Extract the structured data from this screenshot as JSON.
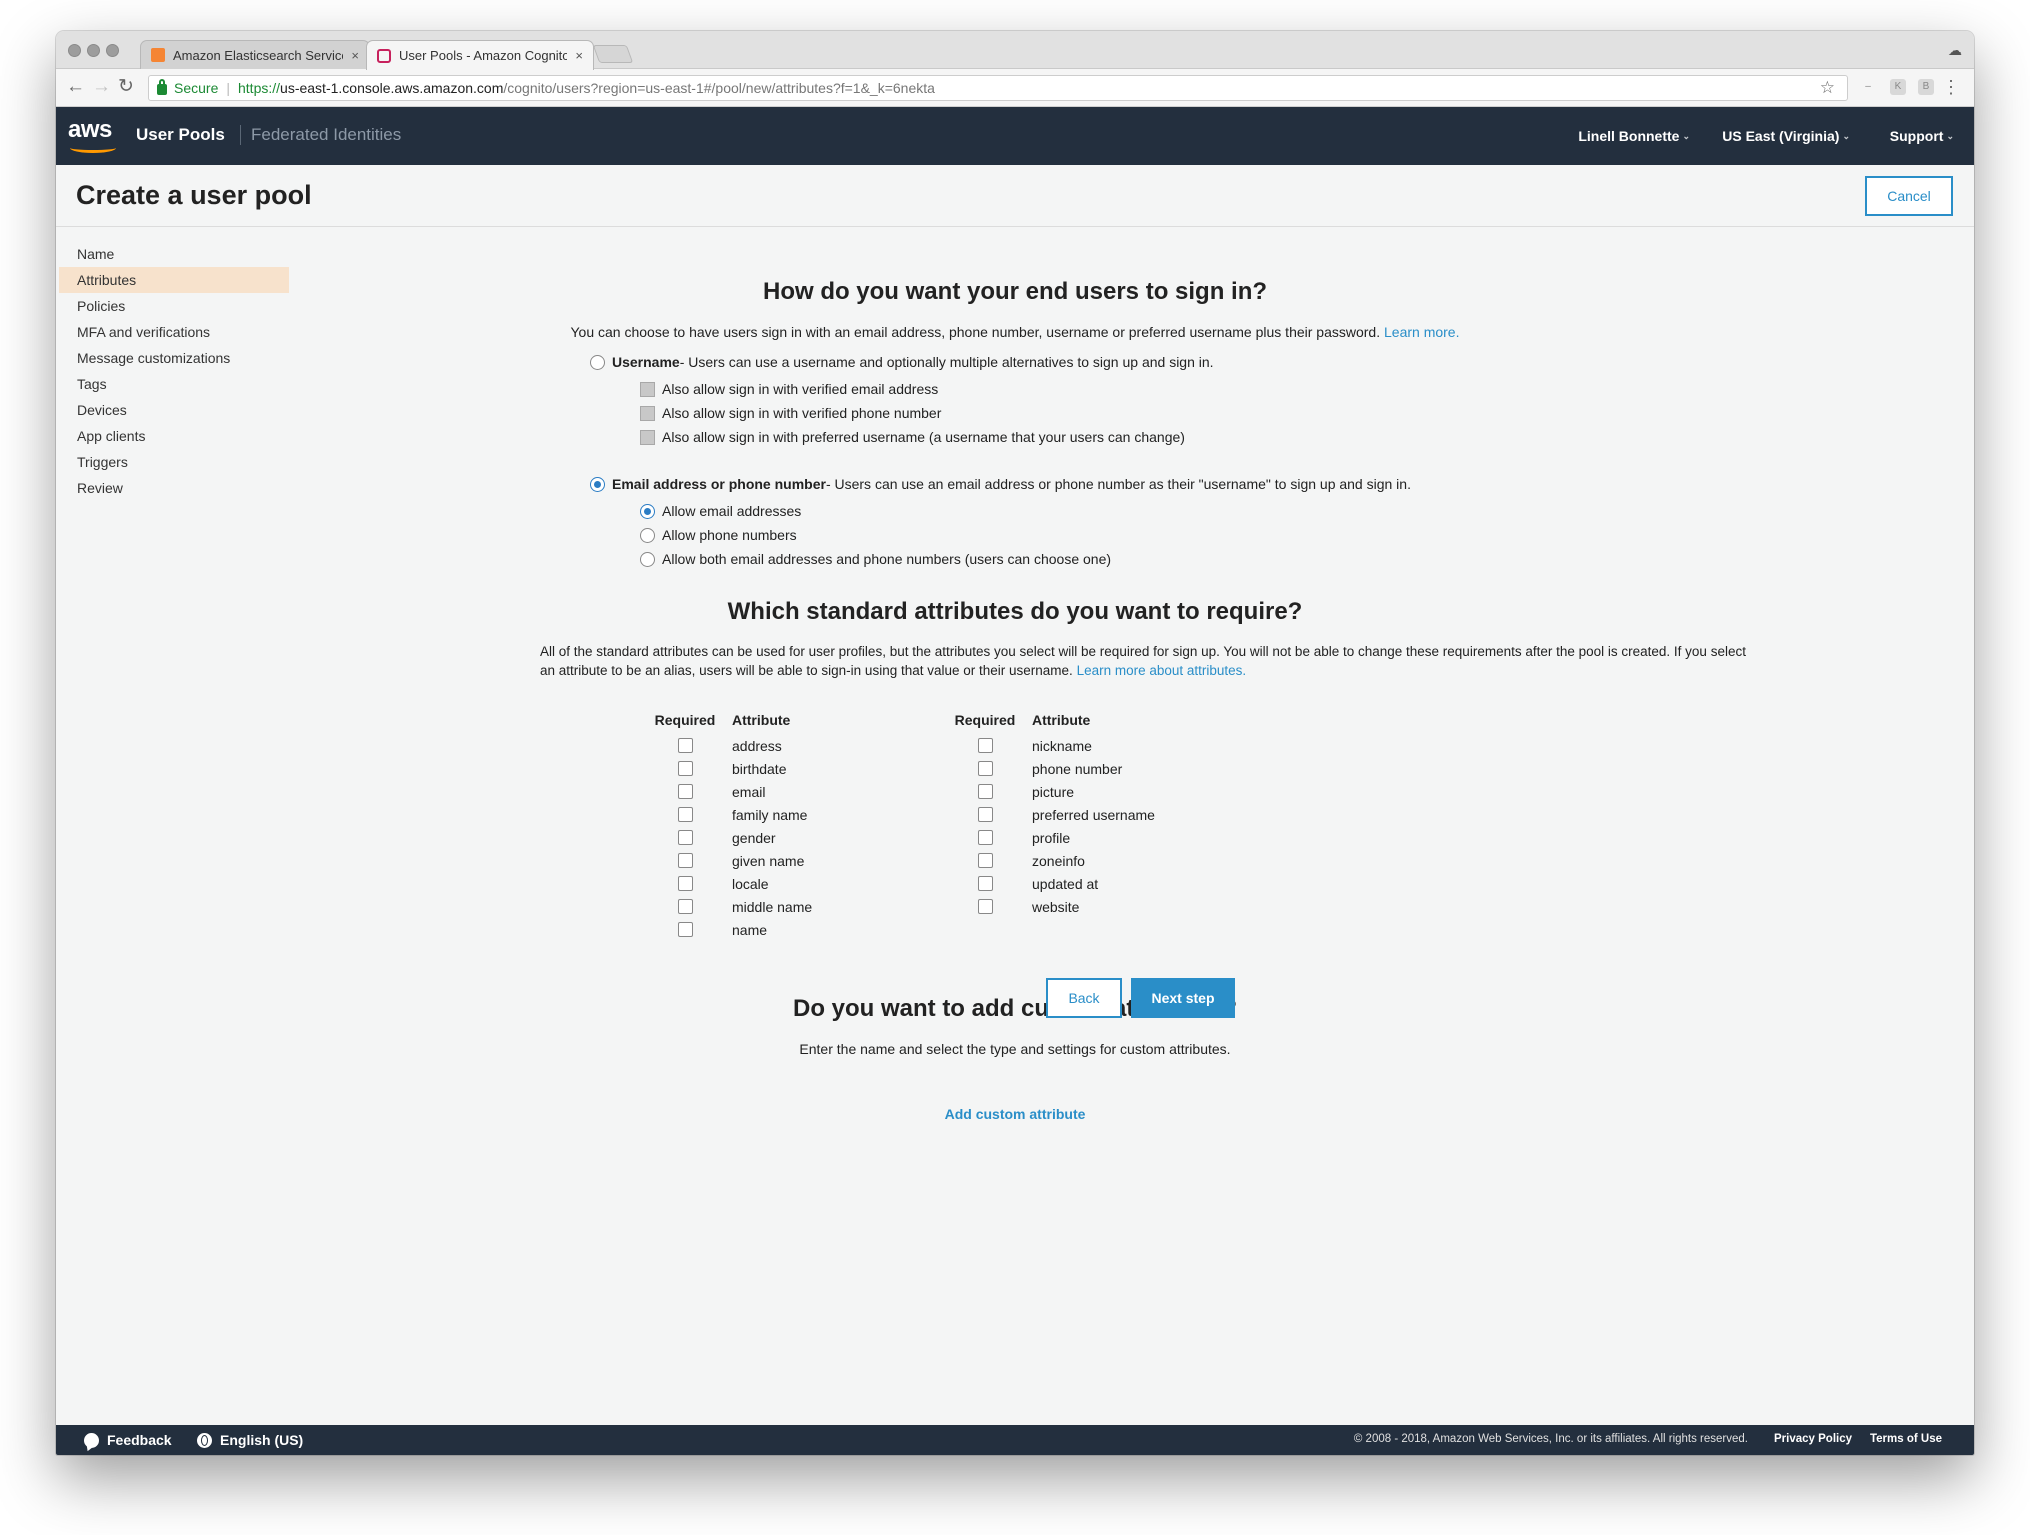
{
  "browser": {
    "tabs": [
      {
        "title": "Amazon Elasticsearch Service",
        "close": "×",
        "favicon_color": "#f58534"
      },
      {
        "title": "User Pools - Amazon Cognito",
        "close": "×",
        "favicon_color": "#c7215d"
      }
    ],
    "secure_label": "Secure",
    "url_scheme": "https://",
    "url_host": "us-east-1.console.aws.amazon.com",
    "url_path": "/cognito/users?region=us-east-1#/pool/new/attributes?f=1&_k=6nekta",
    "back_icon": "←",
    "forward_icon": "→",
    "reload_icon": "↻",
    "star_icon": "☆",
    "menu_icon": "⋮"
  },
  "header": {
    "logo": "aws",
    "service": "User Pools",
    "secondary": "Federated Identities",
    "user": "Linell Bonnette",
    "region": "US East (Virginia)",
    "support": "Support",
    "caret": "⌄",
    "colors": {
      "bar": "#232f3e",
      "smile": "#ff9900"
    }
  },
  "page": {
    "title": "Create a user pool",
    "cancel": "Cancel"
  },
  "sidebar": {
    "items": [
      {
        "label": "Name",
        "active": false
      },
      {
        "label": "Attributes",
        "active": true
      },
      {
        "label": "Policies",
        "active": false
      },
      {
        "label": "MFA and verifications",
        "active": false
      },
      {
        "label": "Message customizations",
        "active": false
      },
      {
        "label": "Tags",
        "active": false
      },
      {
        "label": "Devices",
        "active": false
      },
      {
        "label": "App clients",
        "active": false
      },
      {
        "label": "Triggers",
        "active": false
      },
      {
        "label": "Review",
        "active": false
      }
    ]
  },
  "signin": {
    "heading": "How do you want your end users to sign in?",
    "intro": "You can choose to have users sign in with an email address, phone number, username or preferred username plus their password.",
    "learn_more": "Learn more.",
    "username_option": {
      "label": "Username",
      "desc": " - Users can use a username and optionally multiple alternatives to sign up and sign in.",
      "checked": false
    },
    "username_suboptions": [
      "Also allow sign in with verified email address",
      "Also allow sign in with verified phone number",
      "Also allow sign in with preferred username (a username that your users can change)"
    ],
    "email_option": {
      "label": "Email address or phone number",
      "desc": " - Users can use an email address or phone number as their \"username\" to sign up and sign in.",
      "checked": true
    },
    "email_suboptions": [
      {
        "label": "Allow email addresses",
        "checked": true
      },
      {
        "label": "Allow phone numbers",
        "checked": false
      },
      {
        "label": "Allow both email addresses and phone numbers (users can choose one)",
        "checked": false
      }
    ]
  },
  "standard": {
    "heading": "Which standard attributes do you want to require?",
    "desc": "All of the standard attributes can be used for user profiles, but the attributes you select will be required for sign up. You will not be able to change these requirements after the pool is created. If you select an attribute to be an alias, users will be able to sign-in using that value or their username.",
    "learn_more": "Learn more about attributes.",
    "col_required": "Required",
    "col_attribute": "Attribute",
    "left": [
      "address",
      "birthdate",
      "email",
      "family name",
      "gender",
      "given name",
      "locale",
      "middle name",
      "name"
    ],
    "right": [
      "nickname",
      "phone number",
      "picture",
      "preferred username",
      "profile",
      "zoneinfo",
      "updated at",
      "website"
    ]
  },
  "custom": {
    "heading": "Do you want to add custom attributes?",
    "desc": "Enter the name and select the type and settings for custom attributes.",
    "add_link": "Add custom attribute"
  },
  "actions": {
    "back": "Back",
    "next": "Next step"
  },
  "footer": {
    "feedback": "Feedback",
    "language": "English (US)",
    "copyright": "© 2008 - 2018, Amazon Web Services, Inc. or its affiliates. All rights reserved.",
    "privacy": "Privacy Policy",
    "terms": "Terms of Use"
  }
}
